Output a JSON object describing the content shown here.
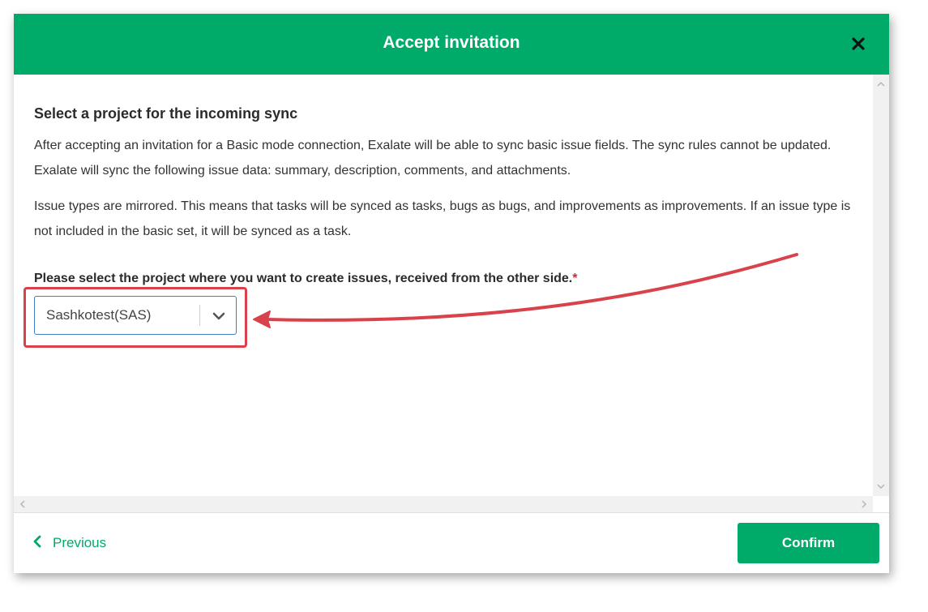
{
  "dialog": {
    "title": "Accept invitation",
    "close_icon": "close-icon"
  },
  "content": {
    "section_title": "Select a project for the incoming sync",
    "paragraph1": "After accepting an invitation for a Basic mode connection, Exalate will be able to sync basic issue fields. The sync rules cannot be updated. Exalate will sync the following issue data: summary, description, comments, and attachments.",
    "paragraph2": "Issue types are mirrored. This means that tasks will be synced as tasks, bugs as bugs, and improvements as improvements. If an issue type is not included in the basic set, it will be synced as a task.",
    "field_label": "Please select the project where you want to create issues, received from the other side.",
    "required_marker": "*",
    "project_select": {
      "selected_value": "Sashkotest(SAS)",
      "icon": "chevron-down-icon"
    }
  },
  "footer": {
    "previous_label": "Previous",
    "previous_icon": "chevron-left-icon",
    "confirm_label": "Confirm"
  },
  "colors": {
    "brand_green": "#00ab6a",
    "annotation_red": "#d9424a",
    "required_red": "#d9262c",
    "focus_blue": "#3d7dca"
  }
}
